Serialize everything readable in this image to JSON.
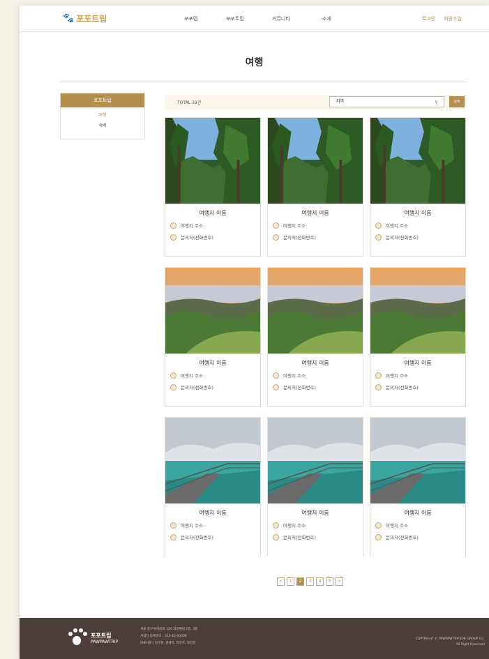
{
  "header": {
    "logo_text": "포포트립",
    "nav": [
      "포포맵",
      "포포트립",
      "커뮤니티",
      "소개"
    ],
    "login": "로그인",
    "signup": "회원가입"
  },
  "page_title": "여행",
  "sidebar": {
    "heading": "포포트립",
    "items": [
      {
        "label": "여행",
        "active": true
      },
      {
        "label": "숙박",
        "active": false
      }
    ]
  },
  "filter": {
    "total": "TOTAL 39건",
    "region_value": "지역",
    "search_label": "검색"
  },
  "cards": [
    {
      "name": "여행지 이름",
      "address": "여행지 주소",
      "contact": "문의처(전화번호)",
      "image": "forest"
    },
    {
      "name": "여행지 이름",
      "address": "여행지 주소",
      "contact": "문의처(전화번호)",
      "image": "forest"
    },
    {
      "name": "여행지 이름",
      "address": "여행지 주소",
      "contact": "문의처(전화번호)",
      "image": "forest"
    },
    {
      "name": "여행지 이름",
      "address": "여행지 주소",
      "contact": "문의처(전화번호)",
      "image": "mountain"
    },
    {
      "name": "여행지 이름",
      "address": "여행지 주소",
      "contact": "문의처(전화번호)",
      "image": "mountain"
    },
    {
      "name": "여행지 이름",
      "address": "여행지 주소",
      "contact": "문의처(전화번호)",
      "image": "mountain"
    },
    {
      "name": "여행지 이름",
      "address": "여행지 주소",
      "contact": "문의처(전화번호)",
      "image": "sea"
    },
    {
      "name": "여행지 이름",
      "address": "여행지 주소",
      "contact": "문의처(전화번호)",
      "image": "sea"
    },
    {
      "name": "여행지 이름",
      "address": "여행지 주소",
      "contact": "문의처(전화번호)",
      "image": "sea"
    }
  ],
  "pagination": {
    "prev": "<",
    "pages": [
      "1",
      "2",
      "3",
      "4",
      "5"
    ],
    "current": "2",
    "next": ">"
  },
  "footer": {
    "brand_ko": "포포트립",
    "brand_en": "PAWPAWTRIP",
    "info": [
      "서울 중구 남대문로 120 대일빌딩 2층, 3층",
      "사업자 등록번호 : 123-45-00000",
      "대표사원 | 김우현, 김성아, 박유주, 정민경"
    ],
    "copyright": "COPYRIGHT © PAWPAWTRIP JOB GROUP Inc.",
    "rights": "All Right Reserved"
  },
  "colors": {
    "accent": "#b38e4d",
    "footer_bg": "#4e3e3a",
    "filter_bg": "#fbf6ea"
  }
}
